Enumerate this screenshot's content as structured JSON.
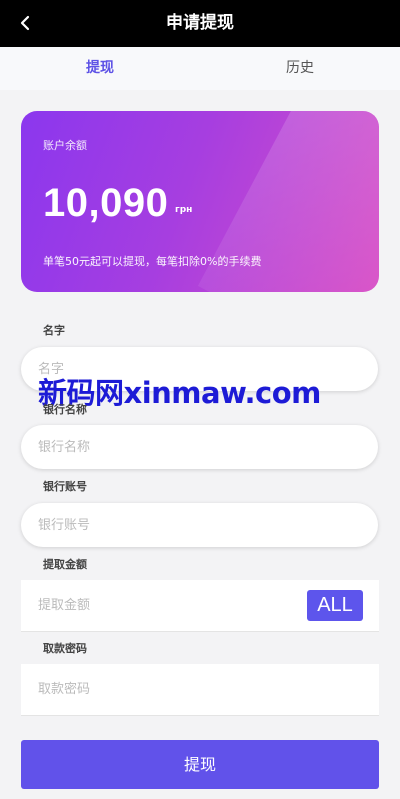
{
  "header": {
    "title": "申请提现"
  },
  "tabs": [
    {
      "label": "提现",
      "active": true
    },
    {
      "label": "历史",
      "active": false
    }
  ],
  "balance": {
    "label": "账户余额",
    "amount": "10,090",
    "currency": "грн",
    "note": "单笔50元起可以提现，每笔扣除0%的手续费"
  },
  "fields": {
    "name": {
      "label": "名字",
      "placeholder": "名字"
    },
    "bank_name": {
      "label": "银行名称",
      "placeholder": "银行名称"
    },
    "bank_account": {
      "label": "银行账号",
      "placeholder": "银行账号"
    },
    "amount": {
      "label": "提取金额",
      "placeholder": "提取金额",
      "all_label": "ALL"
    },
    "password": {
      "label": "取款密码",
      "placeholder": "取款密码"
    }
  },
  "submit_label": "提现",
  "watermark": "新码网xinmaw.com",
  "colors": {
    "accent": "#5d55ec",
    "header_bg": "#000000",
    "card_gradient_start": "#8b37ee",
    "card_gradient_end": "#d84fc6"
  },
  "icons": {
    "back": "chevron-left-icon"
  }
}
